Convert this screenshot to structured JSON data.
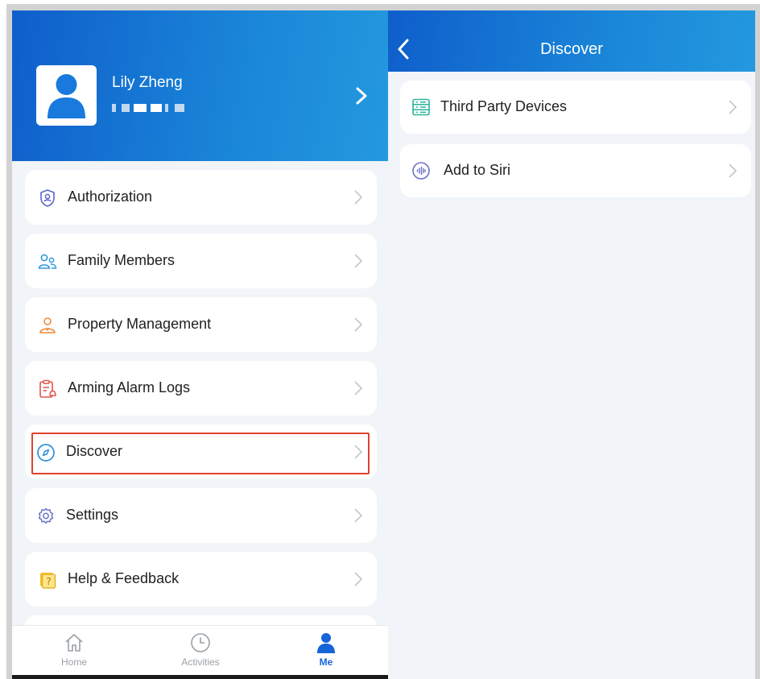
{
  "profile": {
    "name": "Lily Zheng"
  },
  "menu": {
    "items": [
      {
        "label": "Authorization",
        "icon": "shield-user-icon"
      },
      {
        "label": "Family Members",
        "icon": "family-members-icon"
      },
      {
        "label": "Property Management",
        "icon": "property-management-icon"
      },
      {
        "label": "Arming Alarm Logs",
        "icon": "alarm-log-icon"
      },
      {
        "label": "Discover",
        "icon": "compass-icon"
      },
      {
        "label": "Settings",
        "icon": "gear-icon"
      },
      {
        "label": "Help & Feedback",
        "icon": "help-icon"
      }
    ]
  },
  "tabbar": {
    "home": "Home",
    "activities": "Activities",
    "me": "Me"
  },
  "discover": {
    "title": "Discover",
    "items": [
      {
        "label": "Third Party Devices",
        "icon": "devices-list-icon"
      },
      {
        "label": "Add to Siri",
        "icon": "siri-icon"
      }
    ]
  },
  "colors": {
    "header_start": "#0f5ecb",
    "header_end": "#2499de",
    "highlight": "#e0432e",
    "active_tab": "#1565d8",
    "inactive_tab": "#9aa0a6"
  }
}
